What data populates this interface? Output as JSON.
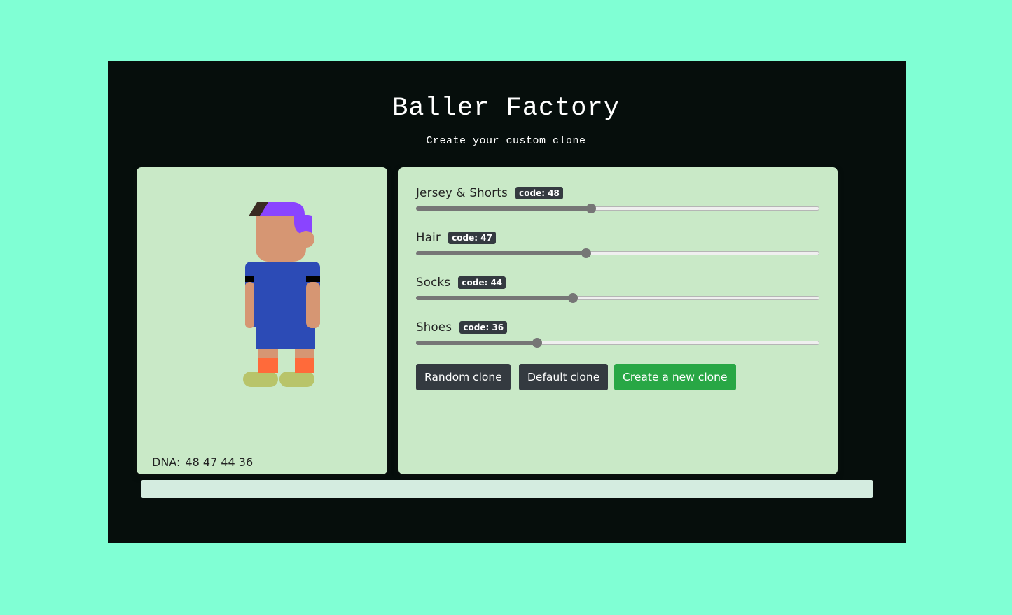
{
  "header": {
    "title": "Baller Factory",
    "subtitle": "Create your custom clone"
  },
  "preview": {
    "dna_label": "DNA:",
    "dna_values": "48 47 44 36"
  },
  "controls": {
    "jersey": {
      "label": "Jersey & Shorts",
      "badge": "code: 48",
      "value": 48,
      "min": 10,
      "max": 98
    },
    "hair": {
      "label": "Hair",
      "badge": "code: 47",
      "value": 47,
      "min": 10,
      "max": 98
    },
    "socks": {
      "label": "Socks",
      "badge": "code: 44",
      "value": 44,
      "min": 10,
      "max": 98
    },
    "shoes": {
      "label": "Shoes",
      "badge": "code: 36",
      "value": 36,
      "min": 10,
      "max": 98
    }
  },
  "buttons": {
    "random": "Random clone",
    "default": "Default clone",
    "create": "Create a new clone"
  },
  "colors": {
    "page_bg": "#80ffd4",
    "app_bg": "#060e0c",
    "panel_bg": "#c9e9c7",
    "jersey": "#2c4bb6",
    "hair": "#8a44ff",
    "socks": "#ff6a3a",
    "shoes": "#b8c46a",
    "skin": "#d69673",
    "button_dark": "#343a40",
    "button_green": "#28a745"
  },
  "icons": {
    "character": "baller-avatar"
  }
}
